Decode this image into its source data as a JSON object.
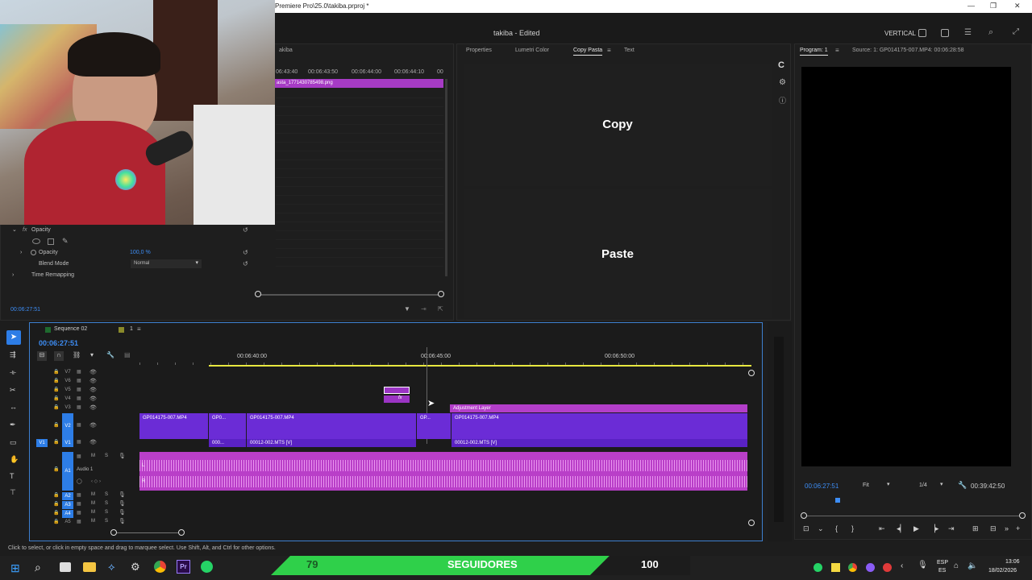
{
  "window": {
    "title": "Premiere Pro\\25.0\\takiba.prproj *",
    "minimize": "—",
    "maximize": "❐",
    "close": "✕"
  },
  "header": {
    "project_name": "takiba",
    "separator": " - ",
    "project_state": "Edited",
    "workspace": "VERTICAL"
  },
  "source_panel": {
    "tab_label": "akiba",
    "ruler_ticks": [
      "06:43:40",
      "00:06:43:50",
      "00:06:44:00",
      "00:06:44:10",
      "00"
    ],
    "clip_name": "asta_1771430785498.png"
  },
  "effect_controls": {
    "section_label": "Opacity",
    "property_opacity_label": "Opacity",
    "property_opacity_value": "100,0 %",
    "blend_mode_label": "Blend Mode",
    "blend_mode_value": "Normal",
    "time_remapping_label": "Time Remapping",
    "timecode": "00:06:27:51"
  },
  "middle_panel": {
    "tabs": [
      "Properties",
      "Lumetri Color",
      "Copy Pasta",
      "Text"
    ],
    "active_tab": "Copy Pasta",
    "copy_label": "Copy",
    "paste_label": "Paste"
  },
  "program_monitor": {
    "tab_program": "Program: 1",
    "tab_source": "Source: 1: GP014175-007.MP4: 00:06:28:58",
    "timecode": "00:06:27:51",
    "fit": "Fit",
    "resolution": "1/4",
    "duration": "00:39:42:50"
  },
  "timeline": {
    "sequence_name": "Sequence 02",
    "sequence_count": "1",
    "timecode": "00:06:27:51",
    "ruler_labels": [
      "00:06:40:00",
      "00:06:45:00",
      "00:06:50:00"
    ],
    "video_tracks": [
      "V7",
      "V6",
      "V5",
      "V4",
      "V3",
      "V2",
      "V1"
    ],
    "audio_tracks": [
      "A1",
      "A2",
      "A3",
      "A4",
      "A5"
    ],
    "source_patch_v": "V1",
    "audio1_name": "Audio 1",
    "audio_btn_m": "M",
    "audio_btn_s": "S",
    "clips": {
      "v3_adjustment": "Adjustment Layer",
      "v2_a": "GP014175-007.MP4",
      "v2_b": "GP0...",
      "v2_c": "GP014175-007.MP4",
      "v2_d": "GP...",
      "v2_e": "GP014175-007.MP4",
      "v1_a": "000...",
      "v1_b": "00012-002.MTS [V]",
      "v1_c": "00012-002.MTS [V]",
      "fx": "fx",
      "audio_l": "L",
      "audio_r": "R"
    }
  },
  "status_bar": {
    "hint": "Click to select, or click in empty space and drag to marquee select. Use Shift, Alt, and Ctrl for other options."
  },
  "overlay": {
    "count_left": "79",
    "label": "SEGUIDORES",
    "count_right": "100"
  },
  "taskbar": {
    "lang_top": "ESP",
    "lang_bottom": "ES",
    "time": "13:06",
    "date": "18/02/2026"
  },
  "colors": {
    "video_clip": "#6b2cd6",
    "adjustment_clip": "#b33ec9",
    "audio_clip": "#b93fc8",
    "accent_blue": "#2d7de6",
    "work_area": "#e8e840",
    "overlay_green": "#2fd04a"
  }
}
